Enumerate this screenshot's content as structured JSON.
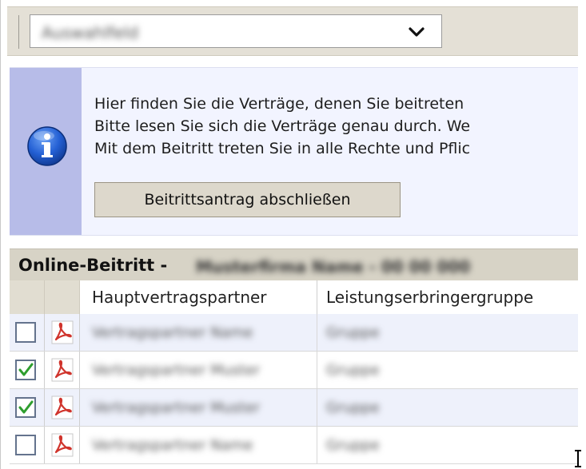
{
  "contract_selector": {
    "selected_value": "Auswahlfeld"
  },
  "info": {
    "lines": [
      "Hier finden Sie die Verträge, denen Sie beitreten",
      "Bitte lesen Sie sich die Verträge genau durch. We",
      "Mit dem Beitritt treten Sie in alle Rechte und Pflic"
    ],
    "button_label": "Beitrittsantrag abschließen"
  },
  "section": {
    "title": "Online-Beitritt -",
    "subtitle_blurred": "Musterfirma Name - 00 00 000"
  },
  "table": {
    "columns": [
      "Hauptvertragspartner",
      "Leistungserbringergruppe"
    ],
    "rows": [
      {
        "checked": false,
        "partner": "Vertragspartner Name",
        "group": "Gruppe"
      },
      {
        "checked": true,
        "partner": "Vertragspartner Muster",
        "group": "Gruppe"
      },
      {
        "checked": true,
        "partner": "Vertragspartner Muster",
        "group": "Gruppe"
      },
      {
        "checked": false,
        "partner": "Vertragspartner Name",
        "group": "Gruppe"
      }
    ]
  },
  "colors": {
    "toolbar_bg": "#e4e0d6",
    "info_bg": "#f2f4ff",
    "info_rail": "#b7bce8",
    "header_bg": "#d7d3c6",
    "row_alt": "#eef1fb",
    "check_green": "#2e9e2e",
    "pdf_red": "#d0342c"
  },
  "icons": {
    "dropdown": "chevron-down-icon",
    "info": "info-icon",
    "pdf": "pdf-icon",
    "check": "checkmark-icon"
  }
}
